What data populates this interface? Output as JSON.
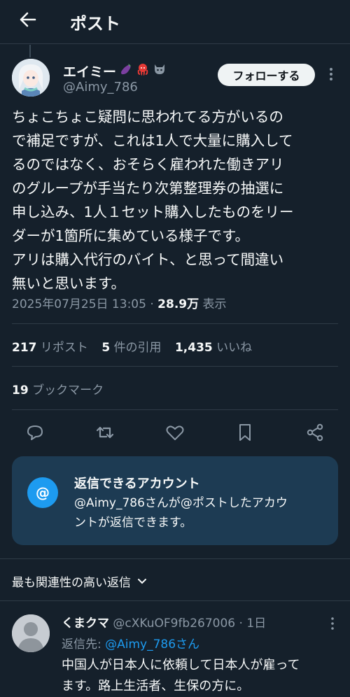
{
  "header": {
    "back_icon": "arrow-left-icon",
    "title": "ポスト"
  },
  "post": {
    "author_name": "エイミー",
    "name_emojis": [
      "eggplant-icon",
      "octopus-icon",
      "demon-icon"
    ],
    "handle": "@Aimy_786",
    "follow_label": "フォローする",
    "body_lines": [
      "ちょこちょこ疑問に思われてる方がいるの",
      "で補足ですが、これは1人で大量に購入して",
      "るのではなく、おそらく雇われた働きアリ",
      "のグループが手当たり次第整理券の抽選に",
      "申し込み、1人１セット購入したものをリー",
      "ダーが1箇所に集めている様子です。",
      "アリは購入代行のバイト、と思って間違い",
      "無いと思います。"
    ],
    "timestamp": "2025年07月25日 13:05",
    "separator": "·",
    "views": "28.9万",
    "views_label": "表示",
    "reposts_count": "217",
    "reposts_label": "リポスト",
    "quotes_count": "5",
    "quotes_label": "件の引用",
    "likes_count": "1,435",
    "likes_label": "いいね",
    "bookmarks_count": "19",
    "bookmarks_label": "ブックマーク"
  },
  "actions": [
    "reply-icon",
    "repost-icon",
    "like-icon",
    "bookmark-icon",
    "share-icon"
  ],
  "reply_restriction": {
    "icon": "@",
    "title": "返信できるアカウント",
    "desc_line1": "@Aimy_786さんが@ポストしたアカウ",
    "desc_line2": "ントが返信できます。"
  },
  "sort": {
    "label": "最も関連性の高い返信"
  },
  "reply": {
    "name": "くまクマ",
    "handle": "@cXKuOF9fb267006",
    "time": "1日",
    "separator": "·",
    "to_label": "返信先:",
    "to_handle": "@Aimy_786さん",
    "text_lines": [
      "中国人が日本人に依頼して日本人が雇って",
      "ます。路上生活者、生保の方に。"
    ]
  },
  "colors": {
    "background": "#15202b",
    "text": "#f7f9f9",
    "muted": "#8b98a5",
    "accent": "#1d9bf0",
    "card": "#1d3b53"
  }
}
